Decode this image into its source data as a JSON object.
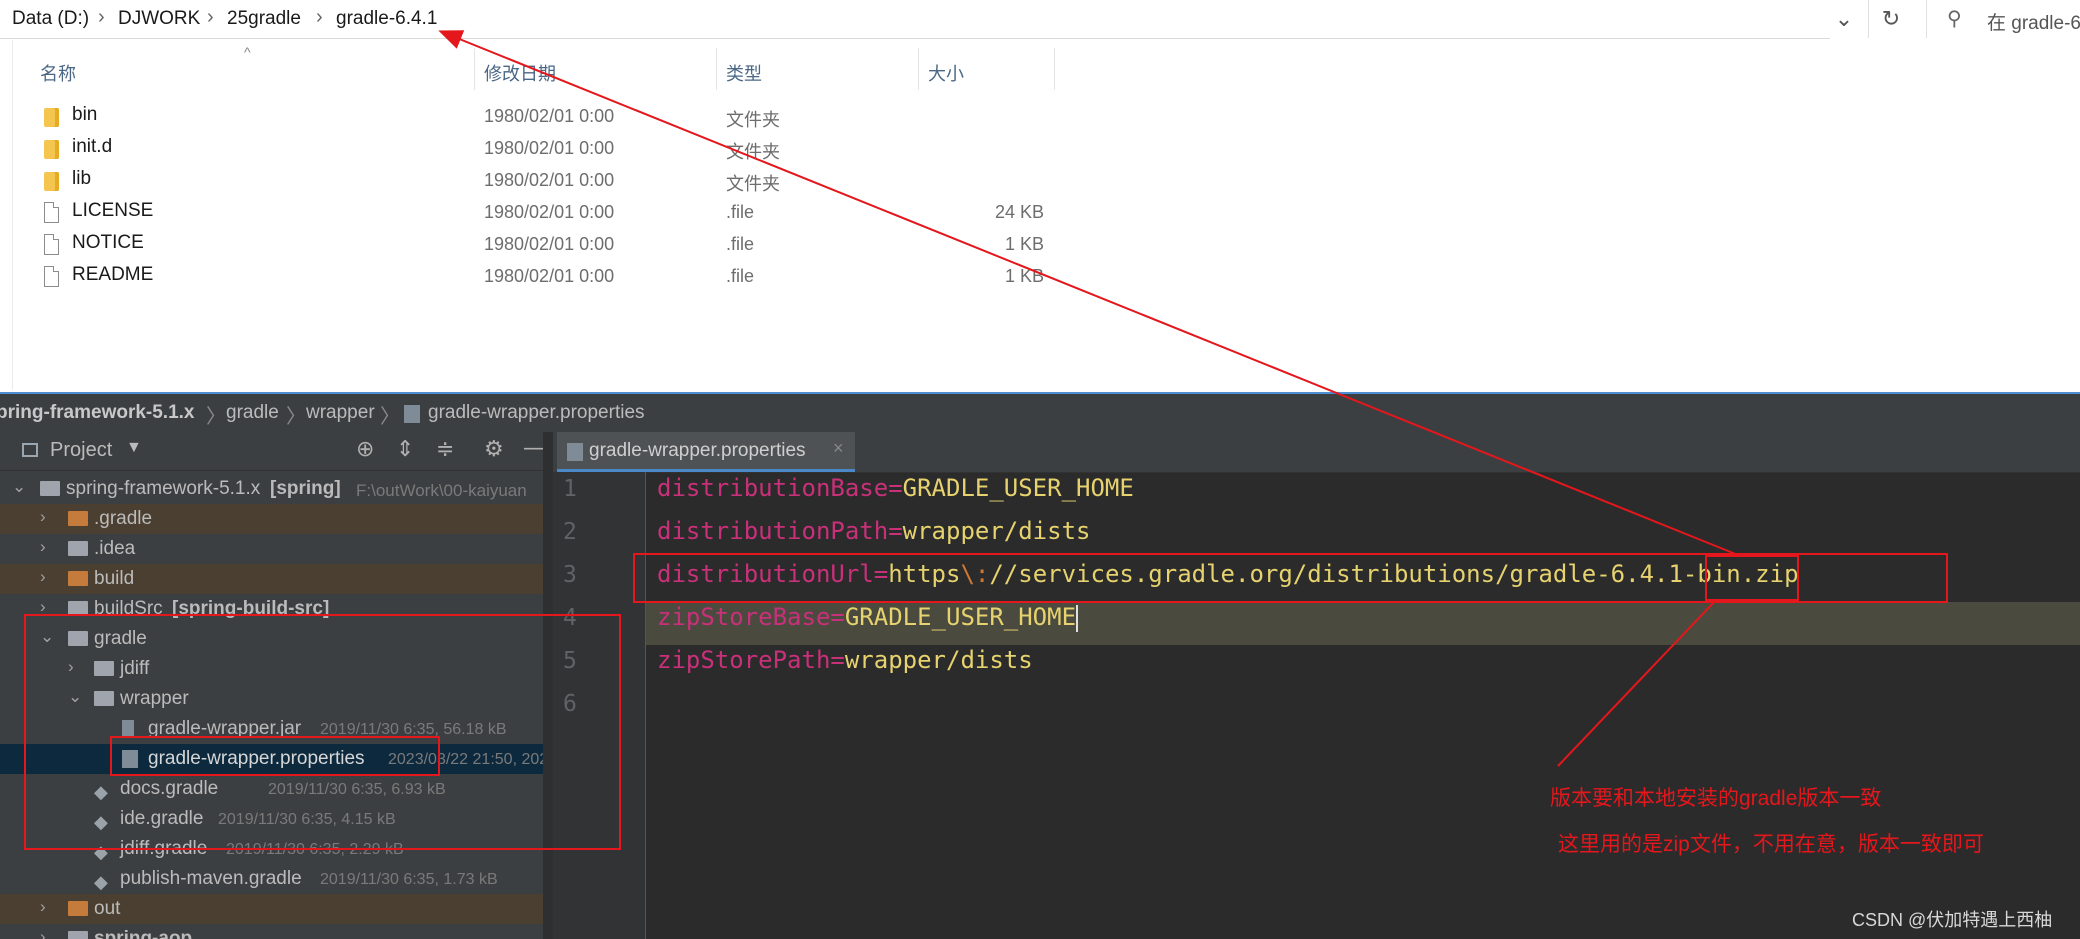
{
  "explorer": {
    "breadcrumbs": [
      "Data (D:)",
      "DJWORK",
      "25gradle",
      "gradle-6.4.1"
    ],
    "search_placeholder": "在 gradle-6",
    "columns": {
      "name": "名称",
      "date": "修改日期",
      "type": "类型",
      "size": "大小"
    },
    "files": [
      {
        "name": "bin",
        "date": "1980/02/01 0:00",
        "type": "文件夹",
        "size": ""
      },
      {
        "name": "init.d",
        "date": "1980/02/01 0:00",
        "type": "文件夹",
        "size": ""
      },
      {
        "name": "lib",
        "date": "1980/02/01 0:00",
        "type": "文件夹",
        "size": ""
      },
      {
        "name": "LICENSE",
        "date": "1980/02/01 0:00",
        "type": ".file",
        "size": "24 KB"
      },
      {
        "name": "NOTICE",
        "date": "1980/02/01 0:00",
        "type": ".file",
        "size": "1 KB"
      },
      {
        "name": "README",
        "date": "1980/02/01 0:00",
        "type": ".file",
        "size": "1 KB"
      }
    ]
  },
  "ide": {
    "nav": [
      "pring-framework-5.1.x",
      "gradle",
      "wrapper",
      "gradle-wrapper.properties"
    ],
    "project_label": "Project",
    "tree": {
      "root_name": "spring-framework-5.1.x",
      "root_module": "[spring]",
      "root_path": "F:\\outWork\\00-kaiyuan",
      "dot_gradle": ".gradle",
      "idea": ".idea",
      "build": "build",
      "buildsrc_name": "buildSrc",
      "buildsrc_module": "[spring-build-src]",
      "gradle": "gradle",
      "jdiff": "jdiff",
      "wrapper": "wrapper",
      "wrapper_jar": "gradle-wrapper.jar",
      "wrapper_jar_meta": "2019/11/30 6:35, 56.18 kB",
      "wrapper_props": "gradle-wrapper.properties",
      "wrapper_props_meta": "2023/03/22 21:50, 202",
      "docs_gradle": "docs.gradle",
      "docs_gradle_meta": "2019/11/30 6:35, 6.93 kB",
      "ide_gradle": "ide.gradle",
      "ide_gradle_meta": "2019/11/30 6:35, 4.15 kB",
      "jdiff_gradle": "jdiff.gradle",
      "jdiff_gradle_meta": "2019/11/30 6:35, 2.29 kB",
      "publish_gradle": "publish-maven.gradle",
      "publish_gradle_meta": "2019/11/30 6:35, 1.73 kB",
      "out": "out",
      "spring_aop": "spring-aop"
    },
    "tab_label": "gradle-wrapper.properties",
    "lines": [
      {
        "num": "1",
        "key": "distributionBase",
        "eq": "=",
        "val": "GRADLE_USER_HOME"
      },
      {
        "num": "2",
        "key": "distributionPath",
        "eq": "=",
        "val": "wrapper/dists"
      },
      {
        "num": "3",
        "key": "distributionUrl",
        "eq": "=",
        "val_a": "https",
        "esc": "\\:",
        "val_b": "//services.gradle.org/distributions/gradle-6.4.1-bin.zip"
      },
      {
        "num": "4",
        "key": "zipStoreBase",
        "eq": "=",
        "val": "GRADLE_USER_HOME"
      },
      {
        "num": "5",
        "key": "zipStorePath",
        "eq": "=",
        "val": "wrapper/dists"
      },
      {
        "num": "6"
      }
    ]
  },
  "annotations": {
    "note1": "版本要和本地安装的gradle版本一致",
    "note2": "这里用的是zip文件，不用在意，版本一致即可",
    "watermark": "CSDN @伏加特遇上西柚"
  },
  "colors": {
    "annotation_red": "#e3171c",
    "ide_bg": "#2b2b2b",
    "key_color": "#c9307a",
    "value_color": "#e6d26e"
  }
}
